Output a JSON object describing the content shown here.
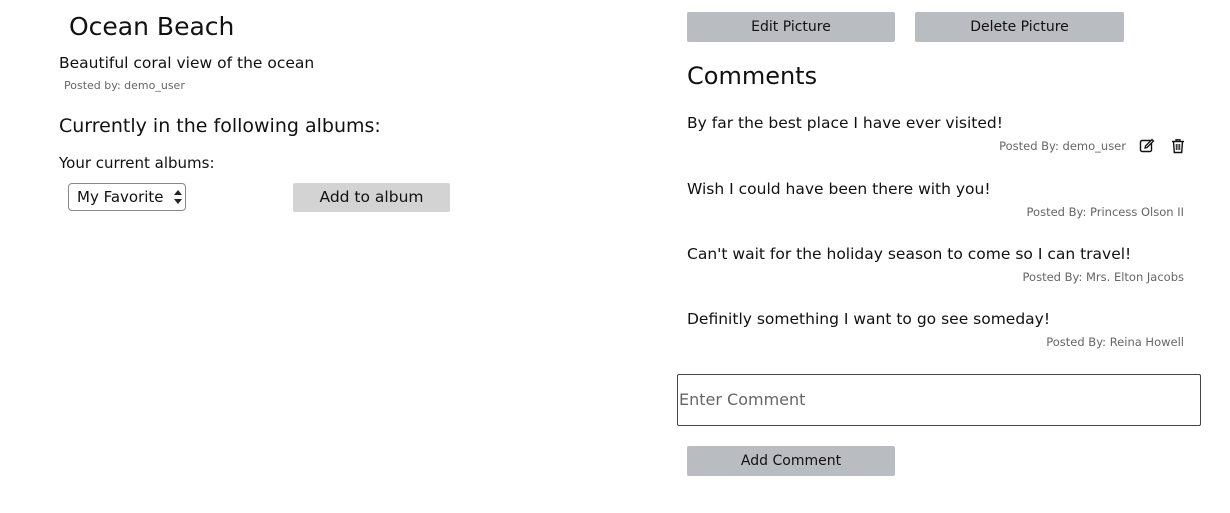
{
  "picture": {
    "title": "Ocean Beach",
    "description": "Beautiful coral view of the ocean",
    "posted_by": "Posted by: demo_user"
  },
  "albums": {
    "heading": "Currently in the following albums:",
    "current_label": "Your current albums:",
    "selected_album": "My Favorite P",
    "add_button": "Add to album"
  },
  "actions": {
    "edit_label": "Edit Picture",
    "delete_label": "Delete Picture"
  },
  "comments": {
    "heading": "Comments",
    "items": [
      {
        "text": "By far the best place I have ever visited!",
        "meta": "Posted By: demo_user",
        "own": true
      },
      {
        "text": "Wish I could have been there with you!",
        "meta": "Posted By: Princess Olson II",
        "own": false
      },
      {
        "text": "Can't wait for the holiday season to come so I can travel!",
        "meta": "Posted By: Mrs. Elton Jacobs",
        "own": false
      },
      {
        "text": "Definitly something I want to go see someday!",
        "meta": "Posted By: Reina Howell",
        "own": false
      }
    ],
    "input_placeholder": "Enter Comment",
    "add_button": "Add Comment"
  },
  "icons": {
    "edit": "edit-icon",
    "delete": "trash-icon"
  },
  "colors": {
    "button_gray": "#b9bcc1",
    "button_light": "#d3d3d3",
    "meta_text": "#666666"
  }
}
